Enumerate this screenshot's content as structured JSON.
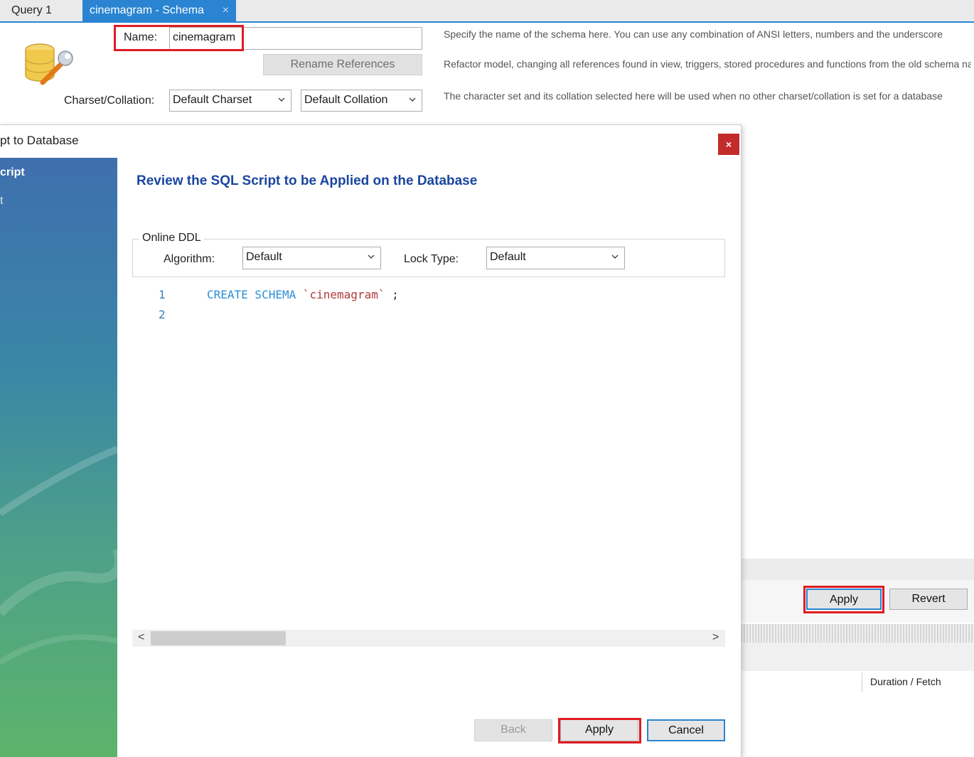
{
  "tabs": [
    {
      "label": "Query 1"
    },
    {
      "label": "cinemagram - Schema",
      "close": "×"
    }
  ],
  "schema": {
    "name_label": "Name:",
    "name_value": "cinemagram",
    "rename_button": "Rename References",
    "charset_label": "Charset/Collation:",
    "charset_value": "Default Charset",
    "collation_value": "Default Collation",
    "hint_name": "Specify the name of the schema here. You can use any combination of ANSI letters, numbers and the underscore",
    "hint_refactor": "Refactor model, changing all references found in view, triggers, stored procedures and functions from the old schema name",
    "hint_charset": "The character set and its collation selected here will be used when no other charset/collation is set for a database"
  },
  "bg_bottom": {
    "apply_button": "Apply",
    "revert_button": "Revert",
    "column_header": "Duration / Fetch"
  },
  "dialog": {
    "title": "pt to Database",
    "close_glyph": "×",
    "sidebar_items": [
      "cript",
      "t"
    ],
    "heading": "Review the SQL Script to be Applied on the Database",
    "online_ddl_legend": "Online DDL",
    "algorithm_label": "Algorithm:",
    "algorithm_value": "Default",
    "lock_label": "Lock Type:",
    "lock_value": "Default",
    "code_lines": [
      {
        "num": "1",
        "kw": "CREATE SCHEMA",
        "str": "`cinemagram`",
        "rest": " ;"
      },
      {
        "num": "2",
        "kw": "",
        "str": "",
        "rest": ""
      }
    ],
    "scroll_left": "<",
    "scroll_right": ">",
    "back_button": "Back",
    "apply_button": "Apply",
    "cancel_button": "Cancel"
  },
  "colors": {
    "accent": "#2a84d2",
    "highlight": "#e01b24",
    "heading": "#1a46a0"
  }
}
